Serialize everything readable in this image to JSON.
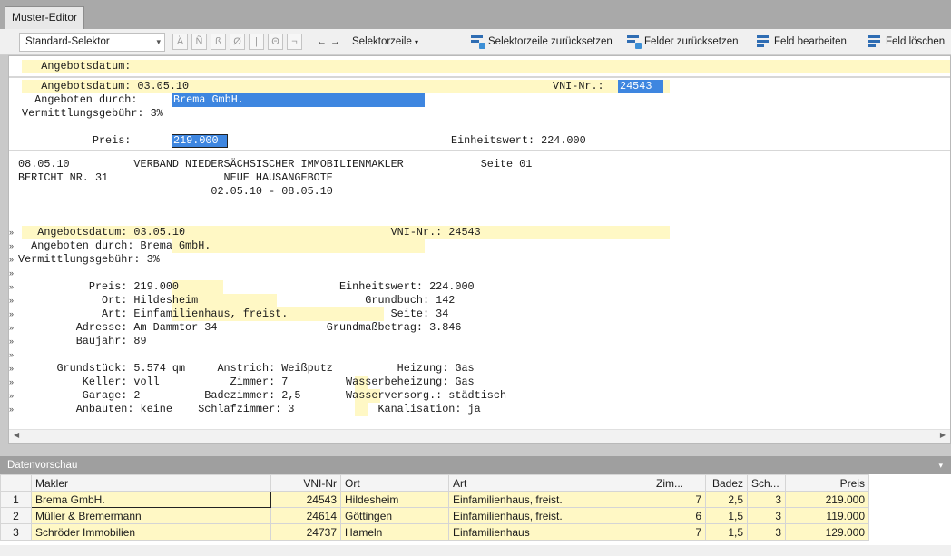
{
  "window": {
    "tab_title": "Muster-Editor"
  },
  "toolbar": {
    "selector_value": "Standard-Selektor",
    "char_buttons": [
      "Ä",
      "Ñ",
      "ß",
      "Ø",
      "|",
      "Θ",
      "¬"
    ],
    "nav_left": "←",
    "nav_right": "→",
    "selector_line_label": "Selektorzeile",
    "reset_selector_line_label": "Selektorzeile zurücksetzen",
    "reset_fields_label": "Felder zurücksetzen",
    "edit_field_label": "Feld bearbeiten",
    "delete_field_label": "Feld löschen"
  },
  "editor": {
    "selector_line": "   Angebotsdatum:",
    "sample": {
      "l1_label": "   Angebotsdatum: 03.05.10",
      "l1_vni_label": "VNI-Nr.: ",
      "l1_vni_value": "24543",
      "l2_label": "  Angeboten durch: ",
      "l2_value": "Brema GmbH.",
      "l3": "Vermittlungsgebühr: 3%",
      "l5_label": "           Preis: ",
      "l5_value": "219.000",
      "l5_right": "Einheitswert: 224.000"
    },
    "report_lines": [
      "08.05.10          VERBAND NIEDERSÄCHSISCHER IMMOBILIENMAKLER            Seite 01",
      "BERICHT NR. 31                  NEUE HAUSANGEBOTE",
      "                              02.05.10 - 08.05.10",
      "",
      "",
      "   Angebotsdatum: 03.05.10                                VNI-Nr.: 24543",
      "  Angeboten durch: Brema GmbH.",
      "Vermittlungsgebühr: 3%",
      "",
      "           Preis: 219.000                         Einheitswert: 224.000",
      "             Ort: Hildesheim                          Grundbuch: 142",
      "             Art: Einfamilienhaus, freist.                Seite: 34",
      "         Adresse: Am Dammtor 34                 Grundmaßbetrag: 3.846",
      "         Baujahr: 89",
      "",
      "      Grundstück: 5.574 qm     Anstrich: Weißputz          Heizung: Gas",
      "          Keller: voll           Zimmer: 7         Wasserbeheizung: Gas",
      "          Garage: 2          Badezimmer: 2,5       Wasserversorg.: städtisch",
      "         Anbauten: keine    Schlafzimmer: 3             Kanalisation: ja"
    ],
    "row_marker": "»"
  },
  "preview": {
    "title": "Datenvorschau",
    "columns": [
      "Makler",
      "VNI-Nr",
      "Ort",
      "Art",
      "Zim...",
      "Badez",
      "Sch...",
      "Preis"
    ],
    "rows": [
      [
        "1",
        "Brema GmbH.",
        "24543",
        "Hildesheim",
        "Einfamilienhaus, freist.",
        "7",
        "2,5",
        "3",
        "219.000"
      ],
      [
        "2",
        "Müller & Bremermann",
        "24614",
        "Göttingen",
        "Einfamilienhaus, freist.",
        "6",
        "1,5",
        "3",
        "119.000"
      ],
      [
        "3",
        "Schröder Immobilien",
        "24737",
        "Hameln",
        "Einfamilienhaus",
        "7",
        "1,5",
        "3",
        "129.000"
      ]
    ]
  },
  "colors": {
    "highlight": "#fff8c5",
    "selection": "#3e86e0",
    "icon_blue": "#2f6db3"
  }
}
